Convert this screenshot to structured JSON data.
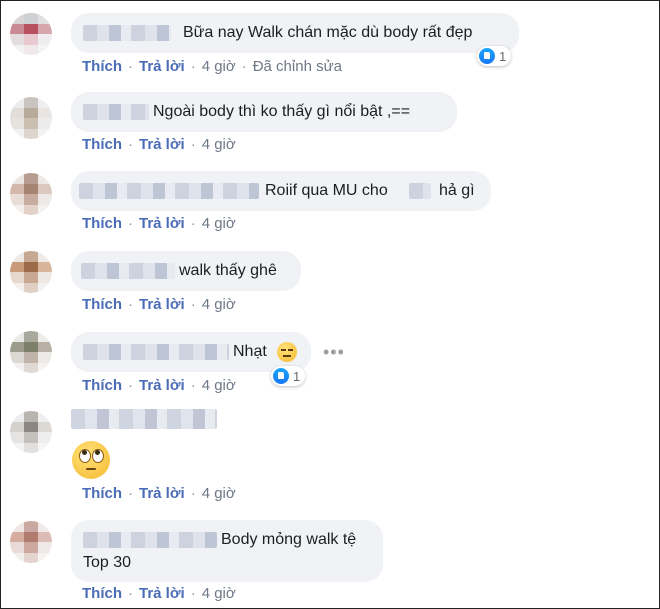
{
  "comments": [
    {
      "text": "Bữa nay Walk chán mặc dù body rất đẹp",
      "reactions": {
        "count": "1",
        "icon": "like-icon"
      },
      "actions": [
        "Thích",
        "Trả lời",
        "4 giờ",
        "Đã chỉnh sửa"
      ]
    },
    {
      "text": "Ngoài body thì ko thấy gì nổi bật ,==",
      "actions": [
        "Thích",
        "Trả lời",
        "4 giờ"
      ]
    },
    {
      "text": "Roiif qua MU cho",
      "text_tail": "hả gì",
      "actions": [
        "Thích",
        "Trả lời",
        "4 giờ"
      ]
    },
    {
      "text": "walk thấy ghê",
      "actions": [
        "Thích",
        "Trả lời",
        "4 giờ"
      ]
    },
    {
      "text": "Nhạt",
      "emoji": "expressionless-face-emoji",
      "reactions": {
        "count": "1",
        "icon": "like-icon"
      },
      "actions": [
        "Thích",
        "Trả lời",
        "4 giờ"
      ]
    },
    {
      "emoji": "face-with-rolling-eyes-emoji",
      "actions": [
        "Thích",
        "Trả lời",
        "4 giờ"
      ]
    },
    {
      "text": "Body mỏng walk tệ",
      "text2": "Top 30",
      "actions": [
        "Thích",
        "Trả lời",
        "4 giờ"
      ]
    }
  ],
  "icons": {
    "more": "more-options-icon",
    "like": "like-icon"
  },
  "colors": {
    "accent": "#4b6cb7",
    "bubble": "#f0f2f5",
    "meta": "#6f7887",
    "like_blue": "#1877f2"
  }
}
